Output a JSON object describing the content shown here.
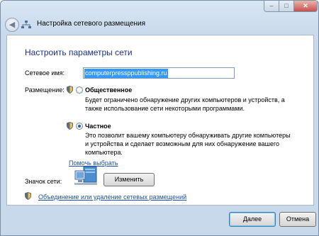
{
  "window": {
    "title": "Настройка сетевого размещения",
    "controls": {
      "minimize": "–",
      "maximize": "□",
      "close": "✕"
    }
  },
  "heading": "Настроить параметры сети",
  "network_name": {
    "label": "Сетевое имя:",
    "value": "computerpressppublishing.ru"
  },
  "placement": {
    "label": "Размещение:",
    "options": [
      {
        "title": "Общественное",
        "description": "Будет ограничено обнаружение других компьютеров и устройств, а также использование сети некоторыми программами.",
        "selected": false
      },
      {
        "title": "Частное",
        "description": "Это позволит вашему компьютеру обнаруживать другие компьютеры и устройства и сделает возможным для них обнаружение вашего компьютера.",
        "selected": true
      }
    ],
    "help_link": "Помочь выбрать"
  },
  "network_icon": {
    "label": "Значок сети:",
    "change_button": "Изменить"
  },
  "merge_link": "Объединение или удаление сетевых размещений",
  "buttons": {
    "next": "Далее",
    "cancel": "Отмена"
  },
  "icons": {
    "back": "back-arrow-icon",
    "network": "network-icon",
    "shield": "uac-shield-icon",
    "computer": "network-computer-icon"
  },
  "colors": {
    "heading": "#1e3287",
    "link": "#1b52a8",
    "selection": "#3399ff"
  }
}
